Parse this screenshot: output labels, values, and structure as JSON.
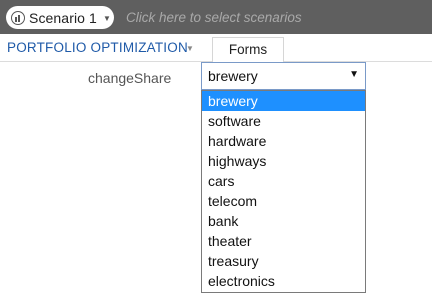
{
  "topbar": {
    "scenario_label": "Scenario 1",
    "scenario_hint": "Click here to select scenarios"
  },
  "nav": {
    "title": "PORTFOLIO OPTIMIZATION",
    "tab_label": "Forms"
  },
  "form": {
    "field_label": "changeShare",
    "selected_value": "brewery",
    "options": [
      "brewery",
      "software",
      "hardware",
      "highways",
      "cars",
      "telecom",
      "bank",
      "theater",
      "treasury",
      "electronics"
    ]
  },
  "colors": {
    "topbar_bg": "#5f5f5f",
    "accent": "#1f5aa8",
    "selected_option_bg": "#1e90ff"
  }
}
